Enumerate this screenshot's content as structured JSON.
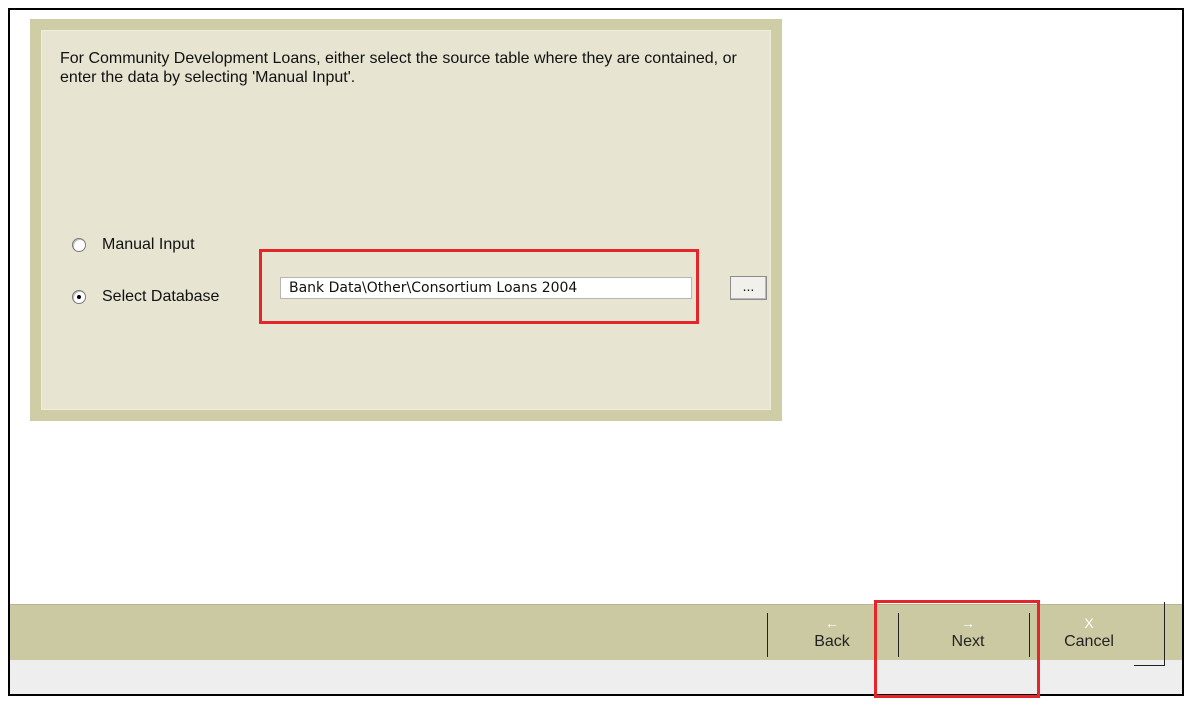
{
  "dialog": {
    "instructions": "For Community Development Loans, either select the source table where they are contained, or enter the data by selecting 'Manual Input'.",
    "options": {
      "manual_input": "Manual Input",
      "select_database": "Select Database",
      "selected": "select_database"
    },
    "database_path": "Bank Data\\Other\\Consortium Loans 2004",
    "browse_label": "..."
  },
  "navigation": {
    "back": {
      "label": "Back",
      "icon": "left-arrow-icon"
    },
    "next": {
      "label": "Next",
      "icon": "right-arrow-icon"
    },
    "cancel": {
      "label": "Cancel",
      "icon": "x-icon",
      "glyph": "X"
    }
  },
  "colors": {
    "panel_border": "#cfcda5",
    "panel_fill": "#e7e4d2",
    "toolbar": "#cbc9a1",
    "highlight": "#e4262a"
  }
}
